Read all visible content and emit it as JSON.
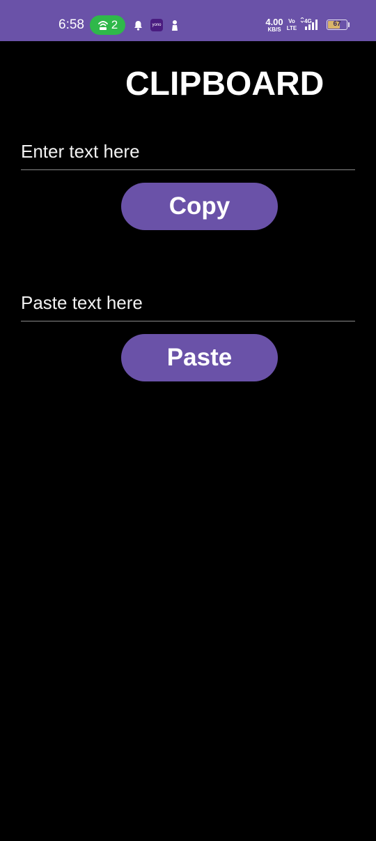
{
  "status_bar": {
    "time": "6:58",
    "hotspot_count": "2",
    "yono_label": "yono",
    "net_speed_value": "4.00",
    "net_speed_unit": "KB/S",
    "volte_top": "Vo",
    "volte_bottom": "LTE",
    "network_type": "4G",
    "battery_level": "67",
    "battery_fraction": 0.67,
    "icons": [
      "hotspot-icon",
      "bell-icon",
      "yono-app-icon",
      "profile-icon",
      "signal-icon",
      "battery-icon"
    ]
  },
  "app": {
    "title": "CLIPBOARD",
    "copy_input": {
      "placeholder": "Enter text here",
      "value": ""
    },
    "copy_button_label": "Copy",
    "paste_input": {
      "placeholder": "Paste text here",
      "value": ""
    },
    "paste_button_label": "Paste"
  },
  "colors": {
    "accent": "#6a52a8",
    "background": "#000000",
    "hotspot_green": "#2fb84a",
    "text": "#ffffff"
  }
}
